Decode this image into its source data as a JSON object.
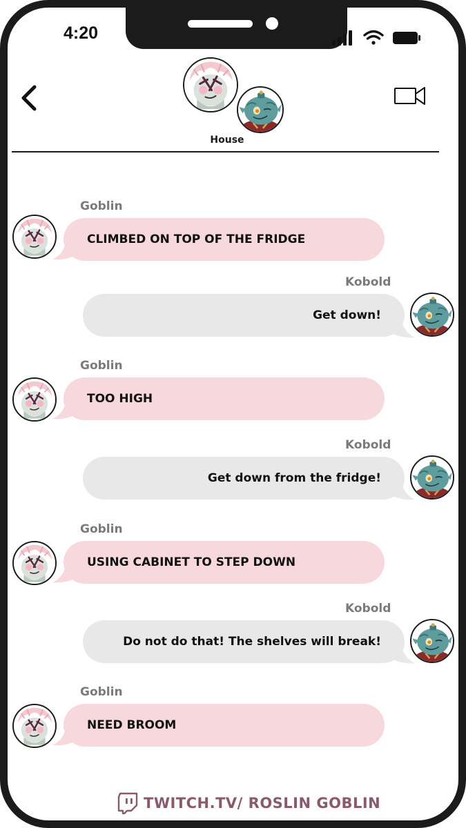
{
  "status_bar": {
    "time": "4:20"
  },
  "header": {
    "group_name": "House"
  },
  "messages": [
    {
      "sender": "Goblin",
      "text": "CLIMBED ON TOP OF THE FRIDGE"
    },
    {
      "sender": "Kobold",
      "text": "Get down!"
    },
    {
      "sender": "Goblin",
      "text": "TOO HIGH"
    },
    {
      "sender": "Kobold",
      "text": "Get down from the fridge!"
    },
    {
      "sender": "Goblin",
      "text": "USING CABINET TO STEP DOWN"
    },
    {
      "sender": "Kobold",
      "text": "Do not do that! The shelves will break!"
    },
    {
      "sender": "Goblin",
      "text": "NEED BROOM"
    }
  ],
  "footer": {
    "text": "TWITCH.TV/ ROSLIN GOBLIN"
  },
  "colors": {
    "goblin_bubble": "#f6d8dd",
    "kobold_bubble": "#e8e8e8",
    "frame": "#1b1b1b",
    "footer": "#8a5a6c"
  }
}
